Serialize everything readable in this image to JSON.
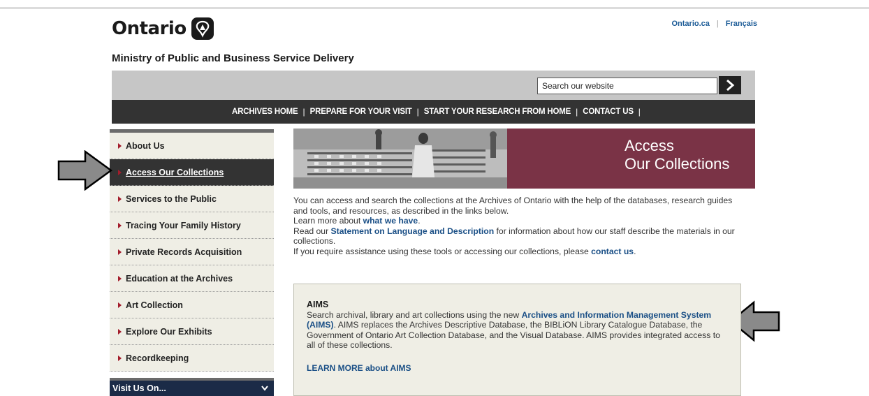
{
  "header": {
    "logo_text": "Ontario",
    "ministry": "Ministry of Public and Business Service Delivery",
    "util_links": [
      "Ontario.ca",
      "Français"
    ]
  },
  "search": {
    "placeholder": "Search our website",
    "button_icon": "chevron-right-icon"
  },
  "main_nav": {
    "items": [
      "ARCHIVES HOME",
      "PREPARE FOR YOUR VISIT",
      "START YOUR RESEARCH FROM HOME",
      "CONTACT US"
    ]
  },
  "sidebar": {
    "items": [
      "About Us",
      "Access Our Collections",
      "Services to the Public",
      "Tracing Your Family History",
      "Private Records Acquisition",
      "Education at the Archives",
      "Art Collection",
      "Explore Our Exhibits",
      "Recordkeeping"
    ],
    "active_index": 1,
    "visit_label": "Visit Us On..."
  },
  "banner": {
    "line1": "Access",
    "line2": "Our Collections"
  },
  "intro": {
    "p1": "You can access and search the collections at the Archives of Ontario with the help of the databases, research guides and tools, and resources, as described in the links below.",
    "p2_pre": "Learn more about ",
    "p2_link": "what we have",
    "p2_post": ".",
    "p3_pre": "Read our ",
    "p3_link": "Statement on Language and Description",
    "p3_post": " for information about how our staff describe the materials in our collections.",
    "p4_pre": "If you require assistance using these tools or accessing our collections, please ",
    "p4_link": "contact us",
    "p4_post": "."
  },
  "aims": {
    "heading": "AIMS",
    "text_pre": "Search archival, library and art collections using the new ",
    "text_link": "Archives and Information Management System (AIMS)",
    "text_post": ".  AIMS replaces the Archives Descriptive Database, the BIBLiON Library Catalogue Database, the Government of Ontario Art Collection Database, and the Visual Database. AIMS provides integrated access to all of these collections.",
    "learn_more": "LEARN MORE about AIMS"
  },
  "colors": {
    "nav_bg": "#333333",
    "banner_bg": "#7a3346",
    "link": "#1a4f86",
    "sidebar_bg": "#efeee5",
    "accent_triangle": "#a31c2b"
  }
}
